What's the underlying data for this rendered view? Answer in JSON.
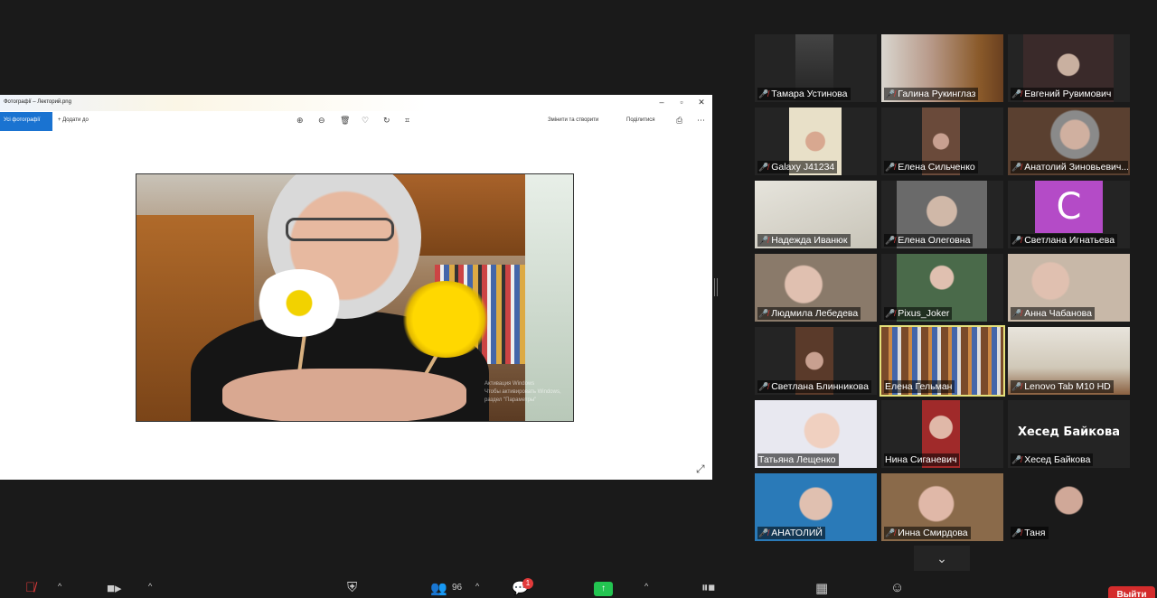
{
  "share": {
    "window_title": "Фотографії – Лекторий.png",
    "toolbar": {
      "all_photos": "Усі фотографії",
      "add_to": "+ Додати до",
      "edit_create": "Змінити та створити",
      "share": "Поділитися"
    },
    "watermark_line1": "Активация Windows",
    "watermark_line2": "Чтобы активировать Windows,",
    "watermark_line3": "раздел \"Параметры\""
  },
  "gallery": [
    {
      "name": "Тамара Устинова",
      "muted": true,
      "active": false
    },
    {
      "name": "Галина Рукинглаз",
      "muted": true,
      "active": false
    },
    {
      "name": "Евгений Рувимович",
      "muted": true,
      "active": false
    },
    {
      "name": "Galaxy J41234",
      "muted": true,
      "active": false
    },
    {
      "name": "Елена Сильченко",
      "muted": true,
      "active": false
    },
    {
      "name": "Анатолий Зиновьевич...",
      "muted": true,
      "active": false
    },
    {
      "name": "Надежда Иванюк",
      "muted": true,
      "active": false
    },
    {
      "name": "Елена Олеговна",
      "muted": true,
      "active": false
    },
    {
      "name": "Светлана Игнатьева",
      "muted": true,
      "active": false,
      "avatar_letter": "C"
    },
    {
      "name": "Людмила Лебедева",
      "muted": true,
      "active": false
    },
    {
      "name": "Pixus_Joker",
      "muted": true,
      "active": false
    },
    {
      "name": "Анна Чабанова",
      "muted": true,
      "active": false
    },
    {
      "name": "Светлана Блинникова",
      "muted": true,
      "active": false
    },
    {
      "name": "Елена Гельман",
      "muted": false,
      "active": true
    },
    {
      "name": "Lenovo Tab M10 HD",
      "muted": true,
      "active": false
    },
    {
      "name": "Татьяна Лещенко",
      "muted": false,
      "active": false
    },
    {
      "name": "Нина Сиганевич",
      "muted": false,
      "active": false
    },
    {
      "name": "Хесед Байкова",
      "muted": true,
      "active": false,
      "big_label": "Хесед Байкова"
    },
    {
      "name": "АНАТОЛИЙ",
      "muted": true,
      "active": false
    },
    {
      "name": "Инна Смирдова",
      "muted": true,
      "active": false
    },
    {
      "name": "Таня",
      "muted": true,
      "active": false
    }
  ],
  "toolbar": {
    "participants_count": "96",
    "chat_badge": "1",
    "leave_label": "Выйти"
  },
  "colors": {
    "bg": "#1a1a1a",
    "active_border": "#e4e07a",
    "muted": "#e23b3b",
    "share_green": "#23c551",
    "leave_red": "#d42c2c",
    "avatar": "#b44bc7"
  }
}
